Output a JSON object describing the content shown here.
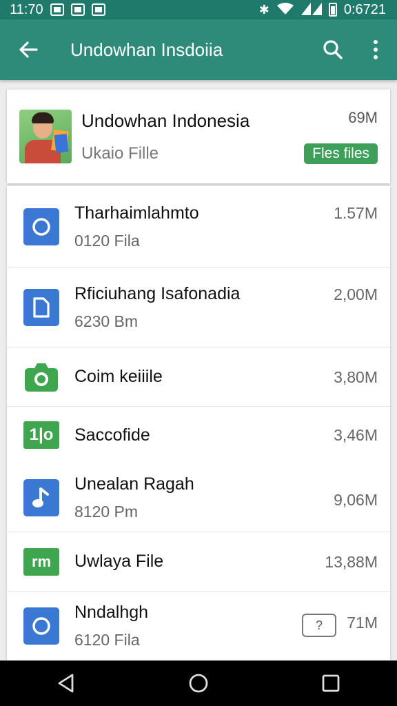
{
  "status_bar": {
    "time": "11:70",
    "clock_right": "0:6721"
  },
  "toolbar": {
    "title": "Undowhan Insdoiia"
  },
  "header": {
    "title": "Undowhan Indonesia",
    "subtitle": "Ukaio Fille",
    "size": "69M",
    "badge": "Fles files"
  },
  "files": [
    {
      "name": "Tharhaimlahmto",
      "sub": "0120 Fila",
      "size": "1.57M",
      "icon": "circle-doc-icon",
      "color": "#3a78d4"
    },
    {
      "name": "Rficiuhang Isafonadia",
      "sub": "6230 Bm",
      "size": "2,00M",
      "icon": "document-icon",
      "color": "#3a78d4"
    },
    {
      "name": "Coim keiiile",
      "sub": "",
      "size": "3,80M",
      "icon": "camera-icon",
      "color": "#3fa54f"
    },
    {
      "name": "Saccofide",
      "sub": "",
      "size": "3,46M",
      "icon": "spreadsheet-icon",
      "color": "#3fa54f"
    },
    {
      "name": "Unealan Ragah",
      "sub": "8120 Pm",
      "size": "9,06M",
      "icon": "music-note-icon",
      "color": "#3a78d4"
    },
    {
      "name": "Uwlaya File",
      "sub": "",
      "size": "13,88M",
      "icon": "sheet-icon",
      "color": "#3fa54f"
    },
    {
      "name": "Nndalhgh",
      "sub": "6120 Fila",
      "size": "71M",
      "icon": "circle-doc-icon",
      "color": "#3a78d4",
      "badge": "?"
    }
  ]
}
